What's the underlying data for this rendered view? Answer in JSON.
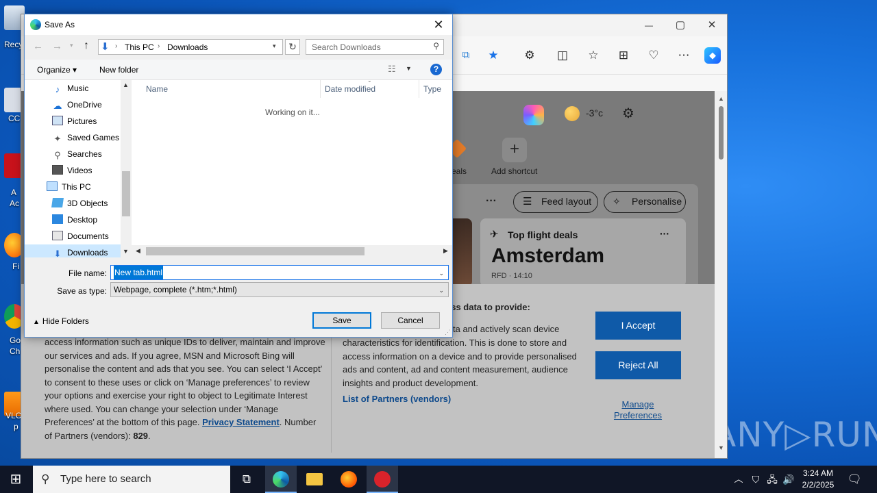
{
  "desktop": {
    "icon_labels": [
      "Recy",
      "CC",
      "A",
      "Ac",
      "Fi",
      "Go",
      "Ch",
      "VLC",
      "p"
    ],
    "watermark": "ANY▷RUN"
  },
  "browser": {
    "title_controls": {
      "minimize": "—",
      "maximize": "▢",
      "close": "✕"
    },
    "toolbar_icons": [
      "screenshot-icon",
      "favorite-star-icon",
      "extensions-icon",
      "split-screen-icon",
      "favorites-icon",
      "collections-icon",
      "browser-essentials-icon",
      "more-icon",
      "copilot-icon"
    ],
    "weather": "-3°c",
    "shortcuts": {
      "deals_label": "eals",
      "add_label": "Add shortcut"
    },
    "feed_layout": "Feed layout",
    "personalise": "Personalise",
    "more_dots": "···",
    "flight_card": {
      "title": "Top flight deals",
      "city": "Amsterdam",
      "sub": "RFD · 14:10"
    },
    "consent": {
      "left_text": "access information such as unique IDs to deliver, maintain and improve our services and ads. If you agree, MSN and Microsoft Bing will personalise the content and ads that you see. You can select ‘I Accept’ to consent to these uses or click on ‘Manage preferences’ to review your options and exercise your right to object to Legitimate Interest where used. You can change your selection under ‘Manage Preferences’ at the bottom of this page.",
      "privacy_link": "Privacy Statement",
      "partners_count_label": "Number of Partners (vendors):",
      "partners_count": "829",
      "mid_heading": "ess data to provide:",
      "mid_text_1": "ta and actively scan device",
      "mid_text_2": "characteristics for identification. This is done to store and access information on a device and to provide personalised ads and content, ad and content measurement, audience insights and product development.",
      "list_partners": "List of Partners (vendors)",
      "accept": "I Accept",
      "reject": "Reject All",
      "manage": "Manage Preferences"
    }
  },
  "dialog": {
    "title": "Save As",
    "address": {
      "root": "This PC",
      "folder": "Downloads"
    },
    "search_placeholder": "Search Downloads",
    "organize": "Organize ▾",
    "new_folder": "New folder",
    "nav_items": [
      "Music",
      "OneDrive",
      "Pictures",
      "Saved Games",
      "Searches",
      "Videos",
      "This PC",
      "3D Objects",
      "Desktop",
      "Documents",
      "Downloads"
    ],
    "columns": {
      "name": "Name",
      "date": "Date modified",
      "type": "Type"
    },
    "status": "Working on it...",
    "file_name_label": "File name:",
    "file_name": "New tab.html",
    "save_type_label": "Save as type:",
    "save_type": "Webpage, complete (*.htm;*.html)",
    "hide_folders": "Hide Folders",
    "save": "Save",
    "cancel": "Cancel"
  },
  "taskbar": {
    "search_placeholder": "Type here to search",
    "time": "3:24 AM",
    "date": "2/2/2025"
  }
}
